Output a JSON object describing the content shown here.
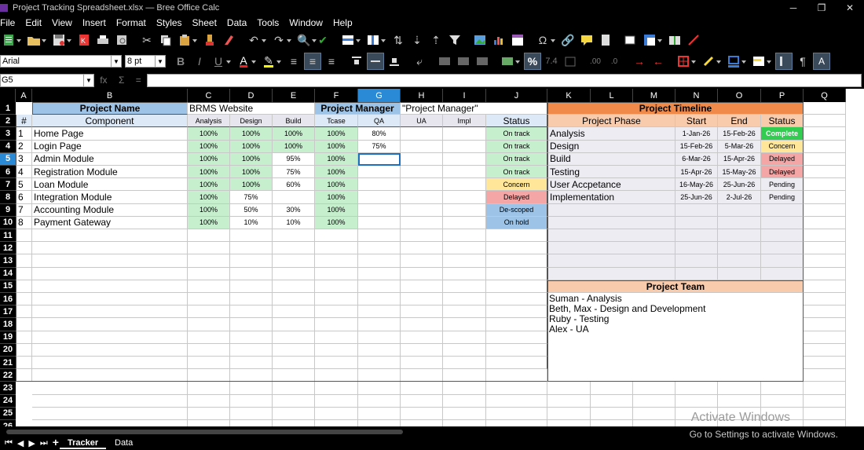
{
  "window": {
    "title": "Project Tracking Spreadsheet.xlsx — Bree Office Calc",
    "minimize": "─",
    "restore": "❐",
    "close": "✕"
  },
  "menu": [
    "File",
    "Edit",
    "View",
    "Insert",
    "Format",
    "Styles",
    "Sheet",
    "Data",
    "Tools",
    "Window",
    "Help"
  ],
  "format_bar": {
    "font_name": "Arial",
    "font_size": "8 pt",
    "number_format_label": "7.4"
  },
  "formula_bar": {
    "cell_ref": "G5",
    "fx": "fx",
    "sigma": "Σ",
    "equals": "="
  },
  "columns": [
    "A",
    "B",
    "C",
    "D",
    "E",
    "F",
    "G",
    "H",
    "I",
    "J",
    "K",
    "L",
    "M",
    "N",
    "O",
    "P",
    "Q"
  ],
  "rows": [
    "1",
    "2",
    "3",
    "4",
    "5",
    "6",
    "7",
    "8",
    "9",
    "10",
    "11",
    "12",
    "13",
    "14",
    "15",
    "16",
    "17",
    "18",
    "19",
    "20",
    "21",
    "22",
    "23",
    "24",
    "25",
    "26"
  ],
  "project": {
    "name_label": "Project Name",
    "name_value": "BRMS Website",
    "manager_label": "Project Manager",
    "manager_value": "\"Project Manager\""
  },
  "headers": {
    "num": "#",
    "component": "Component",
    "analysis": "Analysis",
    "design": "Design",
    "build": "Build",
    "tcase": "Tcase",
    "qa": "QA",
    "ua": "UA",
    "impl": "Impl",
    "status": "Status"
  },
  "components": [
    {
      "n": "1",
      "name": "Home Page",
      "analysis": "100%",
      "design": "100%",
      "build": "100%",
      "tcase": "100%",
      "qa": "80%",
      "ua": "",
      "impl": "",
      "status": "On track"
    },
    {
      "n": "2",
      "name": "Login Page",
      "analysis": "100%",
      "design": "100%",
      "build": "100%",
      "tcase": "100%",
      "qa": "75%",
      "ua": "",
      "impl": "",
      "status": "On track"
    },
    {
      "n": "3",
      "name": "Admin Module",
      "analysis": "100%",
      "design": "100%",
      "build": "95%",
      "tcase": "100%",
      "qa": "",
      "ua": "",
      "impl": "",
      "status": "On track"
    },
    {
      "n": "4",
      "name": "Registration Module",
      "analysis": "100%",
      "design": "100%",
      "build": "75%",
      "tcase": "100%",
      "qa": "",
      "ua": "",
      "impl": "",
      "status": "On track"
    },
    {
      "n": "5",
      "name": "Loan Module",
      "analysis": "100%",
      "design": "100%",
      "build": "60%",
      "tcase": "100%",
      "qa": "",
      "ua": "",
      "impl": "",
      "status": "Concern"
    },
    {
      "n": "6",
      "name": "Integration Module",
      "analysis": "100%",
      "design": "75%",
      "build": "",
      "tcase": "100%",
      "qa": "",
      "ua": "",
      "impl": "",
      "status": "Delayed"
    },
    {
      "n": "7",
      "name": "Accounting Module",
      "analysis": "100%",
      "design": "50%",
      "build": "30%",
      "tcase": "100%",
      "qa": "",
      "ua": "",
      "impl": "",
      "status": "De-scoped"
    },
    {
      "n": "8",
      "name": "Payment Gateway",
      "analysis": "100%",
      "design": "10%",
      "build": "10%",
      "tcase": "100%",
      "qa": "",
      "ua": "",
      "impl": "",
      "status": "On hold"
    }
  ],
  "timeline": {
    "title": "Project Timeline",
    "phase_label": "Project Phase",
    "start_label": "Start",
    "end_label": "End",
    "status_label": "Status",
    "phases": [
      {
        "phase": "Analysis",
        "start": "1-Jan-26",
        "end": "15-Feb-26",
        "status": "Complete"
      },
      {
        "phase": "Design",
        "start": "15-Feb-26",
        "end": "5-Mar-26",
        "status": "Concern"
      },
      {
        "phase": "Build",
        "start": "6-Mar-26",
        "end": "15-Apr-26",
        "status": "Delayed"
      },
      {
        "phase": "Testing",
        "start": "15-Apr-26",
        "end": "15-May-26",
        "status": "Delayed"
      },
      {
        "phase": "User Accpetance",
        "start": "16-May-26",
        "end": "25-Jun-26",
        "status": "Pending"
      },
      {
        "phase": "Implementation",
        "start": "25-Jun-26",
        "end": "2-Jul-26",
        "status": "Pending"
      }
    ]
  },
  "team": {
    "title": "Project Team",
    "members": [
      "Suman - Analysis",
      "Beth, Max - Design and Development",
      "Ruby - Testing",
      "Alex - UA"
    ]
  },
  "tabs": [
    "Tracker",
    "Data"
  ],
  "watermark": {
    "line1": "Activate Windows",
    "line2": "Go to Settings to activate Windows."
  }
}
